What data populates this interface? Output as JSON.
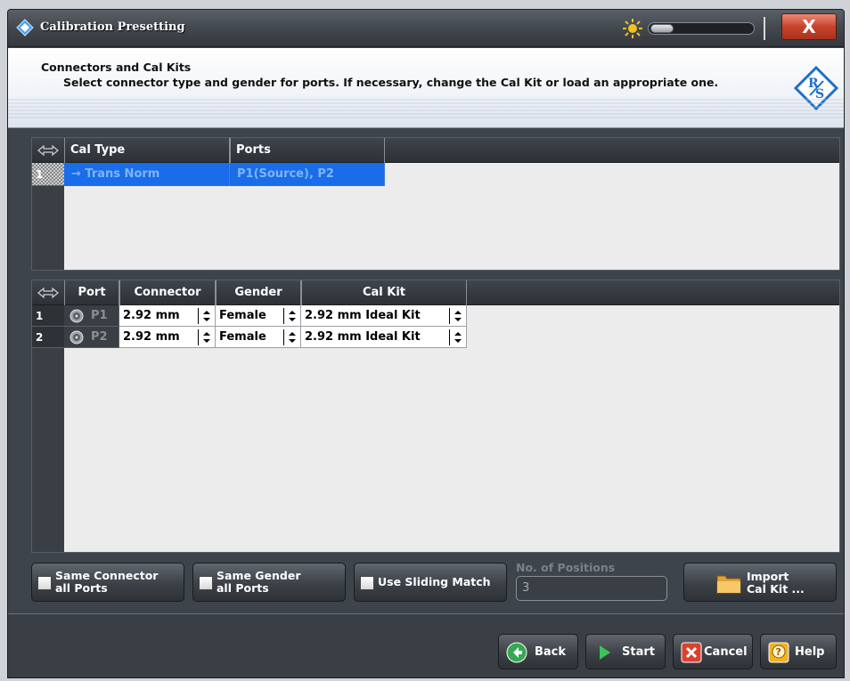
{
  "window": {
    "title": "Calibration Presetting",
    "close_label": "X"
  },
  "info": {
    "title": "Connectors and Cal Kits",
    "description": "Select connector type and gender for ports. If necessary, change the Cal Kit or load an appropriate one."
  },
  "cal_table": {
    "headers": [
      "Cal Type",
      "Ports"
    ],
    "rows": [
      {
        "index": "1",
        "cal_type": "→ Trans Norm",
        "ports": "P1(Source), P2"
      }
    ]
  },
  "port_table": {
    "headers": [
      "Port",
      "Connector",
      "Gender",
      "Cal Kit"
    ],
    "rows": [
      {
        "index": "1",
        "port": "P1",
        "connector": "2.92 mm",
        "gender": "Female",
        "cal_kit": "2.92 mm Ideal Kit"
      },
      {
        "index": "2",
        "port": "P2",
        "connector": "2.92 mm",
        "gender": "Female",
        "cal_kit": "2.92 mm Ideal Kit"
      }
    ]
  },
  "options": {
    "same_connector": {
      "line1": "Same Connector",
      "line2": "all Ports",
      "checked": false
    },
    "same_gender": {
      "line1": "Same Gender",
      "line2": "all Ports",
      "checked": false
    },
    "sliding_match": {
      "label": "Use Sliding Match",
      "checked": false
    },
    "positions_label": "No. of Positions",
    "positions_value": "3",
    "import": {
      "line1": "Import",
      "line2": "Cal Kit ..."
    }
  },
  "footer": {
    "back": "Back",
    "start": "Start",
    "cancel": "Cancel",
    "help": "Help"
  },
  "colors": {
    "selection": "#1a6de8",
    "window_bg": "#3e444b",
    "close_button": "#c9432c"
  }
}
